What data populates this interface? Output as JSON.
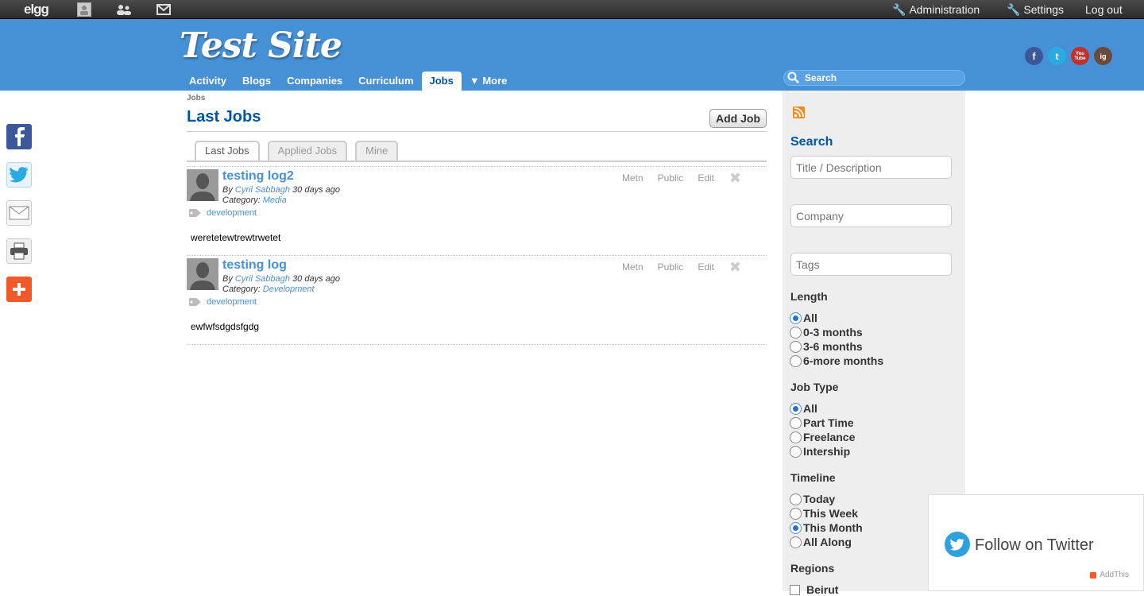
{
  "topbar": {
    "logo": "elgg",
    "administration": "Administration",
    "settings": "Settings",
    "logout": "Log out"
  },
  "header": {
    "site_title": "Test Site",
    "nav": [
      "Activity",
      "Blogs",
      "Companies",
      "Curriculum",
      "Jobs",
      "▼ More"
    ],
    "active_nav": "Jobs",
    "search_placeholder": "Search",
    "social": [
      "f",
      "t",
      "You Tube",
      "ig"
    ]
  },
  "main": {
    "breadcrumb": "Jobs",
    "title": "Last Jobs",
    "add_job": "Add Job",
    "tabs": [
      "Last Jobs",
      "Applied Jobs",
      "Mine"
    ],
    "jobs": [
      {
        "title": "testing log2",
        "by": "By",
        "author": "Cyril Sabbagh",
        "time": "30 days ago",
        "category_label": "Category:",
        "category": "Media",
        "tag": "development",
        "description": "weretetewtrewtrwetet",
        "menu": [
          "Metn",
          "Public",
          "Edit"
        ]
      },
      {
        "title": "testing log",
        "by": "By",
        "author": "Cyril Sabbagh",
        "time": "30 days ago",
        "category_label": "Category:",
        "category": "Development",
        "tag": "development",
        "description": "ewfwfsdgdsfgdg",
        "menu": [
          "Metn",
          "Public",
          "Edit"
        ]
      }
    ]
  },
  "sidebar": {
    "search_title": "Search",
    "title_placeholder": "Title / Description",
    "company_placeholder": "Company",
    "tags_placeholder": "Tags",
    "length_title": "Length",
    "length_options": [
      "All",
      "0-3 months",
      "3-6 months",
      "6-more months"
    ],
    "length_selected": "All",
    "jobtype_title": "Job Type",
    "jobtype_options": [
      "All",
      "Part Time",
      "Freelance",
      "Intership"
    ],
    "jobtype_selected": "All",
    "timeline_title": "Timeline",
    "timeline_options": [
      "Today",
      "This Week",
      "This Month",
      "All Along"
    ],
    "timeline_selected": "This Month",
    "regions_title": "Regions",
    "regions_first": "Beirut"
  },
  "follow": {
    "label": "Follow on Twitter",
    "addthis": "AddThis"
  },
  "colors": {
    "header_blue": "#4690d6",
    "link_blue": "#4690d6",
    "title_blue": "#0054a7",
    "sidebar_bg": "#eeeeee"
  }
}
